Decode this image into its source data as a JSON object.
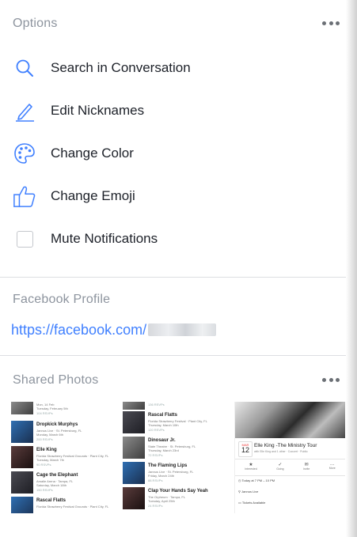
{
  "options": {
    "title": "Options",
    "items": [
      {
        "label": "Search in Conversation",
        "icon": "search-icon"
      },
      {
        "label": "Edit Nicknames",
        "icon": "pencil-icon"
      },
      {
        "label": "Change Color",
        "icon": "palette-icon"
      },
      {
        "label": "Change Emoji",
        "icon": "thumbs-up-icon"
      },
      {
        "label": "Mute Notifications",
        "icon": "checkbox"
      }
    ]
  },
  "profile": {
    "title": "Facebook Profile",
    "link": "https://facebook.com/"
  },
  "shared_photos": {
    "title": "Shared Photos",
    "col1": [
      {
        "title": "",
        "line1": "Mon, 14 Feb",
        "line2": "Tuesday, February 5th",
        "line3": "104 RSVPs"
      },
      {
        "title": "Dropkick Murphys",
        "line1": "Jannus Live · St. Petersburg, FL",
        "line2": "Monday, March 6th",
        "line3": "200 RSVPs"
      },
      {
        "title": "Elle King",
        "line1": "Florida Strawberry Festival Grounds · Plant City, FL",
        "line2": "Tuesday, March 7th",
        "line3": "90 RSVPs"
      },
      {
        "title": "Cage the Elephant",
        "line1": "Amalie Arena · Tampa, FL",
        "line2": "Saturday, March 18th",
        "line3": "150 RSVPs"
      },
      {
        "title": "Rascal Flatts",
        "line1": "Florida Strawberry Festival Grounds · Plant City, FL",
        "line2": "",
        "line3": ""
      }
    ],
    "col2": [
      {
        "title": "",
        "line1": "136 RSVPs",
        "line2": "",
        "line3": ""
      },
      {
        "title": "Rascal Flatts",
        "line1": "Florida Strawberry Festival · Plant City, FL",
        "line2": "Thursday, March 10th",
        "line3": "120 RSVPs"
      },
      {
        "title": "Dinosaur Jr.",
        "line1": "State Theatre · St. Petersburg, FL",
        "line2": "Thursday, March 23rd",
        "line3": "72 RSVPs"
      },
      {
        "title": "The Flaming Lips",
        "line1": "Jannus Live · St. Petersburg, FL",
        "line2": "Friday, March 24th",
        "line3": "88 RSVPs"
      },
      {
        "title": "Clap Your Hands Say Yeah",
        "line1": "The Orpheum · Tampa, FL",
        "line2": "Tuesday, April 25th",
        "line3": "24 RSVPs"
      }
    ],
    "event": {
      "month": "MAR",
      "day": "12",
      "title": "Elle King -The Ministry Tour",
      "subtitle": "with Elle King and 1 other · Concert · Public",
      "actions": [
        "Interested",
        "Going",
        "Invite",
        "More"
      ],
      "details": [
        "Today at 7 PM – 10 PM",
        "Jannus Live",
        "Tickets Available"
      ]
    }
  }
}
